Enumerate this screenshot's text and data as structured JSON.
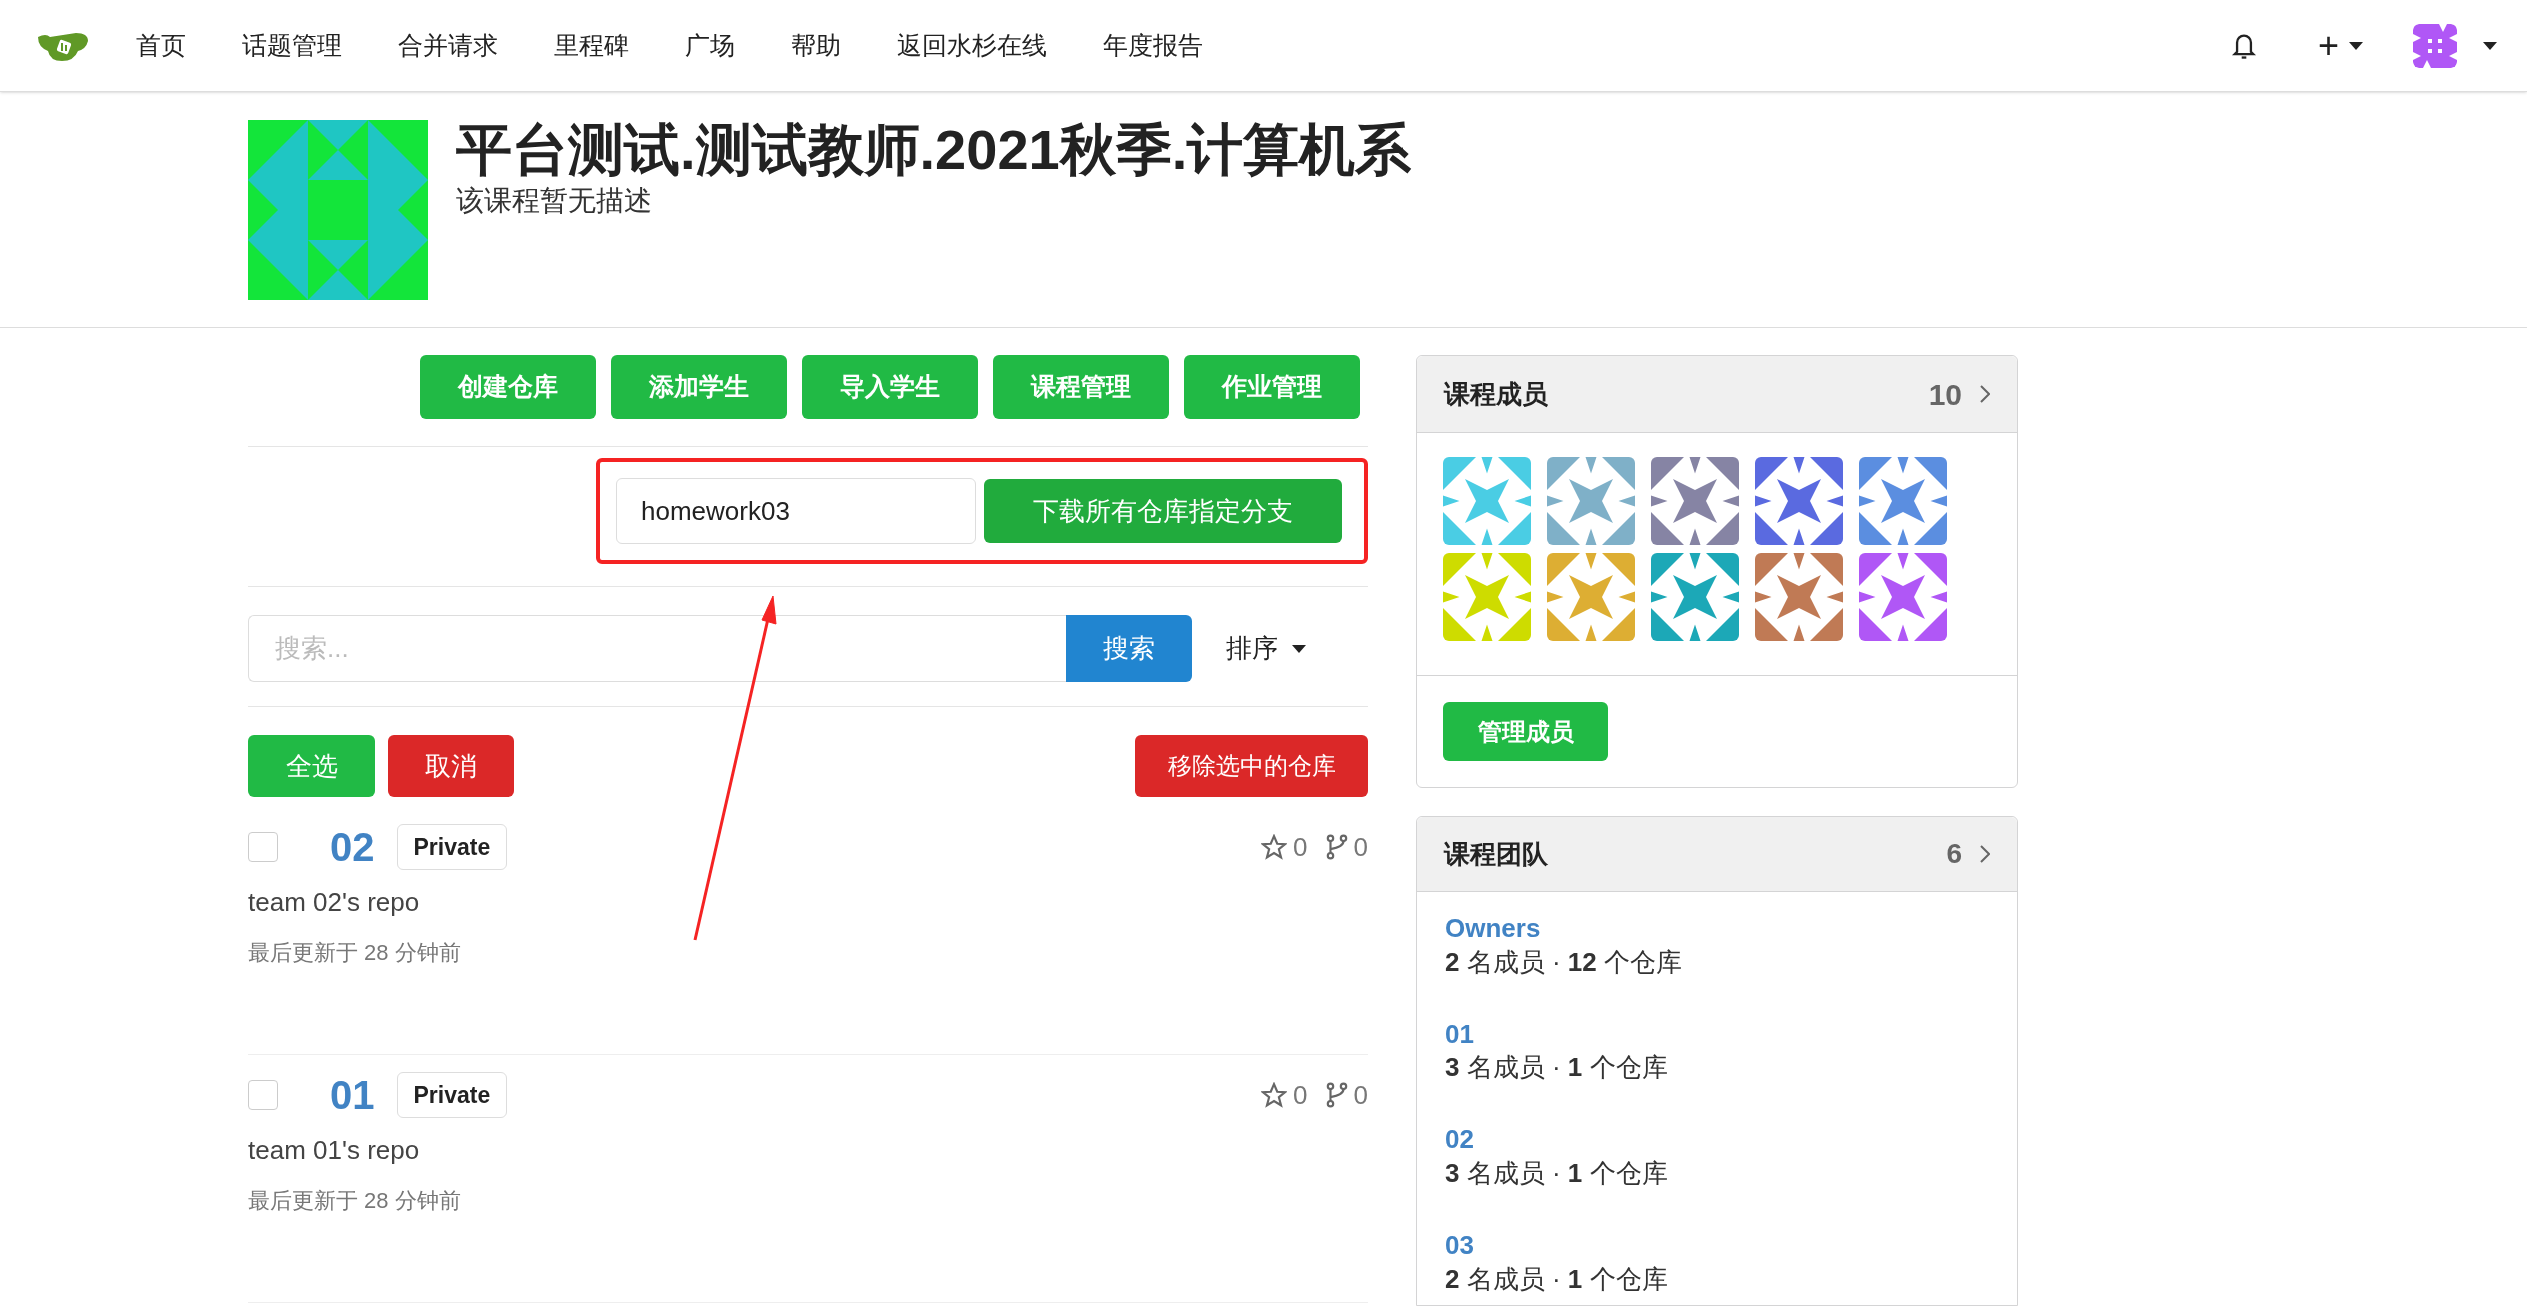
{
  "nav": {
    "items": [
      "首页",
      "话题管理",
      "合并请求",
      "里程碑",
      "广场",
      "帮助",
      "返回水杉在线",
      "年度报告"
    ],
    "create_symbol": "+"
  },
  "course": {
    "title": "平台测试.测试教师.2021秋季.计算机系",
    "description": "该课程暂无描述"
  },
  "actions": [
    "创建仓库",
    "添加学生",
    "导入学生",
    "课程管理",
    "作业管理"
  ],
  "download": {
    "branch_value": "homework03",
    "button": "下载所有仓库指定分支"
  },
  "search": {
    "placeholder": "搜索...",
    "button": "搜索",
    "sort": "排序"
  },
  "bulk": {
    "select_all": "全选",
    "cancel": "取消",
    "remove": "移除选中的仓库"
  },
  "repos": [
    {
      "name": "02",
      "visibility": "Private",
      "checked": false,
      "description": "team 02's repo",
      "updated": "最后更新于 28 分钟前",
      "stars": "0",
      "forks": "0"
    },
    {
      "name": "01",
      "visibility": "Private",
      "checked": false,
      "description": "team 01's repo",
      "updated": "最后更新于 28 分钟前",
      "stars": "0",
      "forks": "0"
    }
  ],
  "members": {
    "title": "课程成员",
    "count": "10",
    "manage_button": "管理成员",
    "items": [
      {
        "color": "#4acde4"
      },
      {
        "color": "#7fb0c8"
      },
      {
        "color": "#8684a4"
      },
      {
        "color": "#5a6ae0"
      },
      {
        "color": "#5b8ee0"
      },
      {
        "color": "#cedc00"
      },
      {
        "color": "#ddae33"
      },
      {
        "color": "#1ca8b7"
      },
      {
        "color": "#c07a55"
      },
      {
        "color": "#b057f6"
      }
    ]
  },
  "teams": {
    "title": "课程团队",
    "count": "6",
    "items": [
      {
        "name": "Owners",
        "meta": "**2** 名成员 · **12** 个仓库"
      },
      {
        "name": "01",
        "meta": "**3** 名成员 · **1** 个仓库"
      },
      {
        "name": "02",
        "meta": "**3** 名成员 · **1** 个仓库"
      },
      {
        "name": "03",
        "meta": "**2** 名成员 · **1** 个仓库"
      }
    ]
  }
}
